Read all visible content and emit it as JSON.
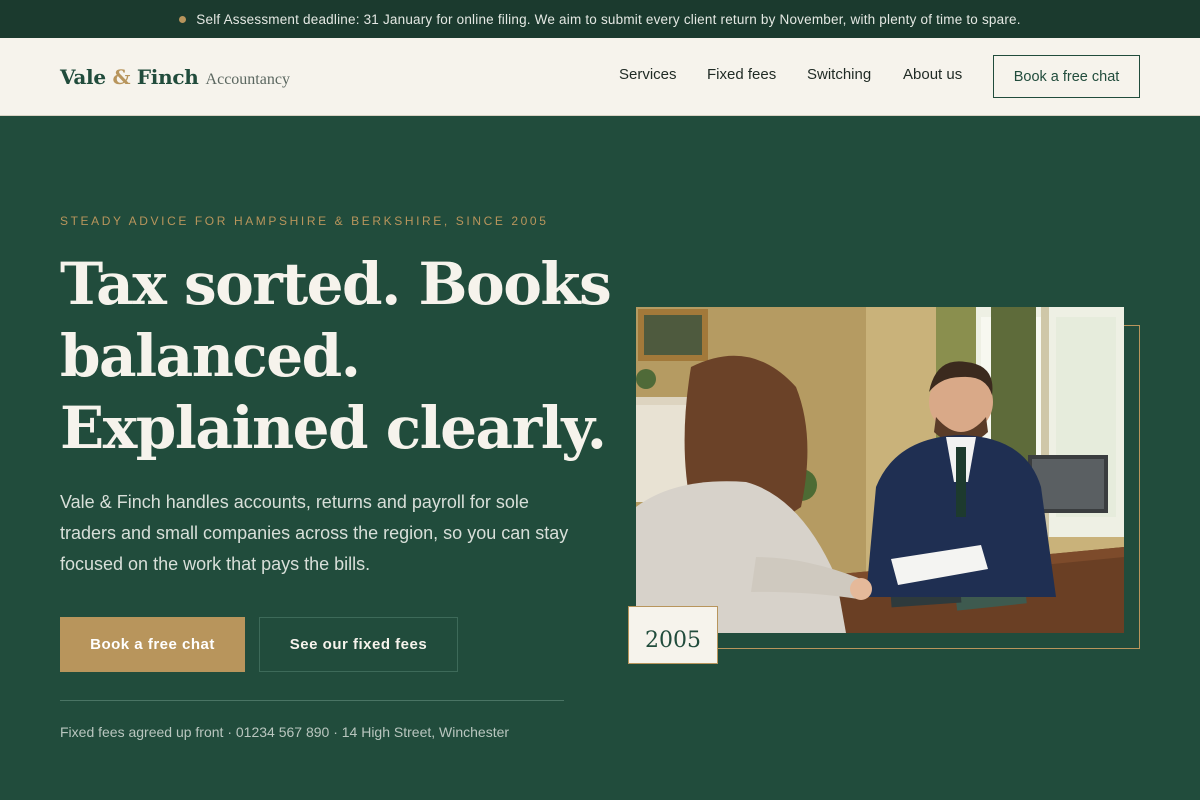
{
  "announcement": {
    "text": "Self Assessment deadline: 31 January for online filing. We aim to submit every client return by November, with plenty of time to spare."
  },
  "header": {
    "brand_name": "Vale",
    "brand_amp": "&",
    "brand_name_2": "Finch",
    "brand_suffix": "Accountancy",
    "nav": [
      {
        "label": "Services"
      },
      {
        "label": "Fixed fees"
      },
      {
        "label": "Switching"
      },
      {
        "label": "About us"
      }
    ],
    "cta_label": "Book a free chat"
  },
  "hero": {
    "eyebrow": "STEADY ADVICE FOR HAMPSHIRE & BERKSHIRE, SINCE 2005",
    "headline": [
      "Tax sorted. Books",
      "balanced.",
      "Explained clearly."
    ],
    "lede": "Vale & Finch handles accounts, returns and payroll for sole traders and small companies across the region, so you can stay focused on the work that pays the bills.",
    "primary_cta": "Book a free chat",
    "secondary_cta": "See our fixed fees",
    "footnote": "Fixed fees agreed up front · 01234 567 890 · 14 High Street, Winchester",
    "year_badge": "2005"
  },
  "colors": {
    "brand_green": "#214c3c",
    "accent_gold": "#b8955c",
    "cream": "#f6f3ec"
  }
}
